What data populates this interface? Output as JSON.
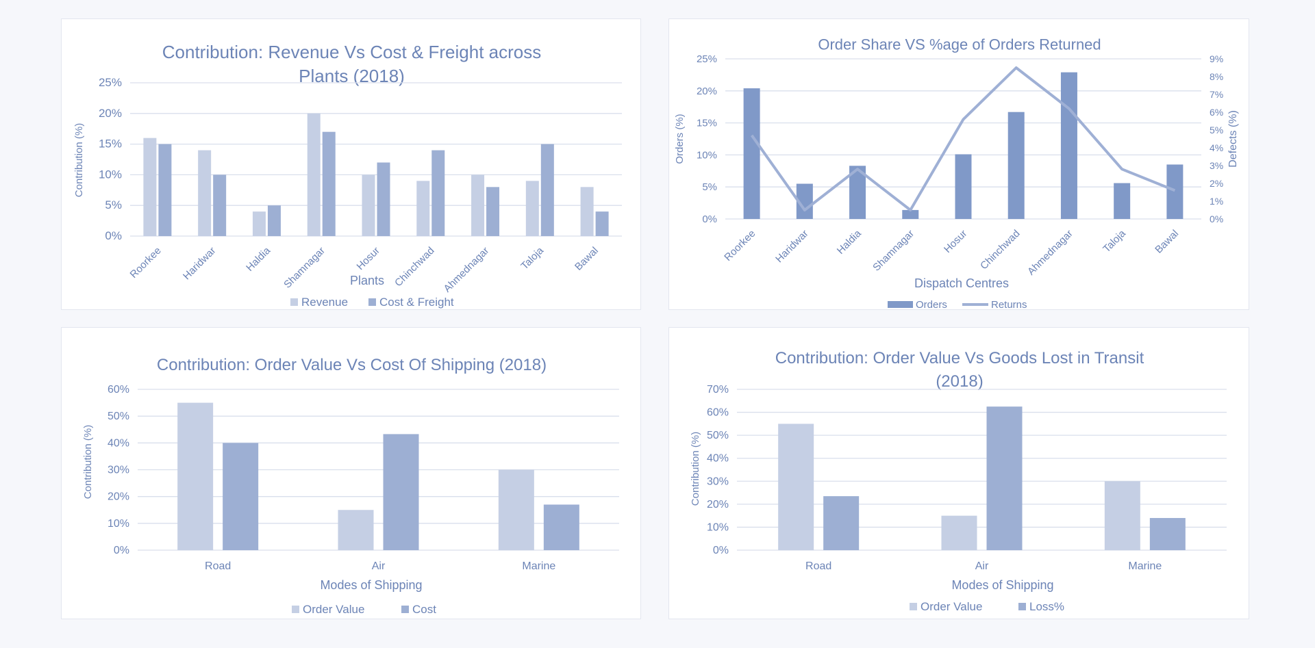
{
  "colors": {
    "light": "#c5cfe4",
    "mid": "#9dafd3",
    "dark": "#8099c8",
    "line": "#9fb0d5",
    "text": "#6c84b6",
    "grid": "#d9dfec"
  },
  "chart_data": [
    {
      "type": "bar",
      "title": "Contribution: Revenue Vs Cost & Freight  across Plants (2018)",
      "title_lines": [
        "Contribution: Revenue Vs Cost & Freight  across",
        "Plants (2018)"
      ],
      "xlabel": "Plants",
      "ylabel": "Contribution (%)",
      "categories": [
        "Roorkee",
        "Haridwar",
        "Haldia",
        "Shamnagar",
        "Hosur",
        "Chinchwad",
        "Ahmednagar",
        "Taloja",
        "Bawal"
      ],
      "series": [
        {
          "name": "Revenue",
          "values": [
            16,
            14,
            4,
            20,
            10,
            9,
            10,
            9,
            8
          ]
        },
        {
          "name": "Cost & Freight",
          "values": [
            15,
            10,
            5,
            17,
            12,
            14,
            8,
            15,
            4
          ]
        }
      ],
      "ylim": [
        0,
        25
      ],
      "yticks": [
        "0%",
        "5%",
        "10%",
        "15%",
        "20%",
        "25%"
      ],
      "legend_position": "bottom",
      "grid": true
    },
    {
      "type": "bar",
      "title": "Order Share VS %age of Orders Returned",
      "title_lines": [
        "Order Share VS %age of Orders Returned"
      ],
      "xlabel": "Dispatch Centres",
      "ylabel": "Orders (%)",
      "y2label": "Defects (%)",
      "categories": [
        "Roorkee",
        "Haridwar",
        "Haldia",
        "Shamnagar",
        "Hosur",
        "Chinchwad",
        "Ahmednagar",
        "Taloja",
        "Bawal"
      ],
      "series": [
        {
          "name": "Orders",
          "type": "bar",
          "axis": "left",
          "values": [
            20.4,
            5.5,
            8.3,
            1.4,
            10.1,
            16.7,
            22.9,
            5.6,
            8.5
          ]
        },
        {
          "name": "Returns",
          "type": "line",
          "axis": "right",
          "values": [
            4.7,
            0.5,
            2.8,
            0.5,
            5.6,
            8.5,
            6.2,
            2.8,
            1.6
          ]
        }
      ],
      "ylim": [
        0,
        25
      ],
      "y2lim": [
        0,
        9
      ],
      "yticks": [
        "0%",
        "5%",
        "10%",
        "15%",
        "20%",
        "25%"
      ],
      "y2ticks": [
        "0%",
        "1%",
        "2%",
        "3%",
        "4%",
        "5%",
        "6%",
        "7%",
        "8%",
        "9%"
      ],
      "legend_position": "bottom",
      "grid": true
    },
    {
      "type": "bar",
      "title": "Contribution: Order Value Vs Cost Of Shipping (2018)",
      "title_lines": [
        "Contribution: Order Value Vs Cost Of Shipping (2018)"
      ],
      "xlabel": "Modes of Shipping",
      "ylabel": "Contribution (%)",
      "categories": [
        "Road",
        "Air",
        "Marine"
      ],
      "series": [
        {
          "name": "Order Value",
          "values": [
            55,
            15,
            30
          ]
        },
        {
          "name": "Cost",
          "values": [
            40,
            43.3,
            17
          ]
        }
      ],
      "ylim": [
        0,
        60
      ],
      "yticks": [
        "0%",
        "10%",
        "20%",
        "30%",
        "40%",
        "50%",
        "60%"
      ],
      "legend_position": "bottom",
      "grid": true
    },
    {
      "type": "bar",
      "title": "Contribution: Order Value Vs Goods Lost in Transit (2018)",
      "title_lines": [
        "Contribution: Order Value Vs Goods Lost in Transit",
        "(2018)"
      ],
      "xlabel": "Modes of Shipping",
      "ylabel": "Contribution (%)",
      "categories": [
        "Road",
        "Air",
        "Marine"
      ],
      "series": [
        {
          "name": "Order Value",
          "values": [
            55,
            15,
            30
          ]
        },
        {
          "name": "Loss%",
          "values": [
            23.5,
            62.5,
            14
          ]
        }
      ],
      "ylim": [
        0,
        70
      ],
      "yticks": [
        "0%",
        "10%",
        "20%",
        "30%",
        "40%",
        "50%",
        "60%",
        "70%"
      ],
      "legend_position": "bottom",
      "grid": true
    }
  ]
}
